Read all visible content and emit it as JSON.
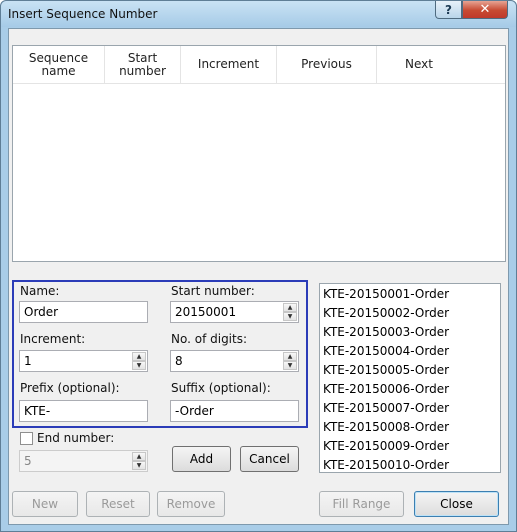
{
  "window": {
    "title": "Insert Sequence Number",
    "help_label": "?",
    "close_label": "✕"
  },
  "table": {
    "columns": [
      "Sequence name",
      "Start number",
      "Increment",
      "Previous",
      "Next"
    ]
  },
  "form": {
    "name_label": "Name:",
    "name_value": "Order",
    "start_label": "Start number:",
    "start_value": "20150001",
    "increment_label": "Increment:",
    "increment_value": "1",
    "digits_label": "No. of digits:",
    "digits_value": "8",
    "prefix_label": "Prefix (optional):",
    "prefix_value": "KTE-",
    "suffix_label": "Suffix (optional):",
    "suffix_value": "-Order",
    "end_label": "End number:",
    "end_value": "5",
    "end_checked": false
  },
  "preview": {
    "items": [
      "KTE-20150001-Order",
      "KTE-20150002-Order",
      "KTE-20150003-Order",
      "KTE-20150004-Order",
      "KTE-20150005-Order",
      "KTE-20150006-Order",
      "KTE-20150007-Order",
      "KTE-20150008-Order",
      "KTE-20150009-Order",
      "KTE-20150010-Order"
    ]
  },
  "buttons": {
    "add": "Add",
    "cancel": "Cancel",
    "new": "New",
    "reset": "Reset",
    "remove": "Remove",
    "fill_range": "Fill Range",
    "close": "Close"
  },
  "colors": {
    "frame_accent": "#2b3cb8",
    "titlebar": "#a9cde8",
    "close_button": "#c74a32"
  }
}
